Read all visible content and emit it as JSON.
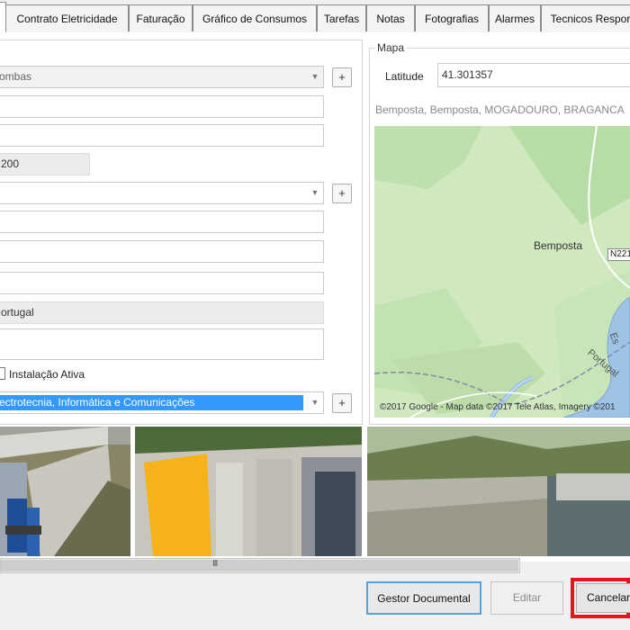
{
  "tabs": [
    "",
    "Contrato Eletricidade",
    "Faturação",
    "Gráfico de Consumos",
    "Tarefas",
    "Notas",
    "Fotografias",
    "Alarmes",
    "Tecnicos Respor"
  ],
  "form": {
    "combo1_value": "ombas",
    "field_code": "200",
    "field_country": "ortugal",
    "checkbox_label": "Instalação Ativa",
    "combo_bottom_value": "ectrotecnia, Informática e Comunicações",
    "plus": "+"
  },
  "map": {
    "group_title": "Mapa",
    "latitude_label": "Latitude",
    "latitude_value": "41.301357",
    "address": "Bemposta, Bemposta, MOGADOURO, BRAGANCA",
    "town_label": "Bemposta",
    "road_label": "N221",
    "river_label_1": "Es",
    "river_label_2": "Portugal",
    "attribution": "©2017 Google - Map data ©2017 Tele Atlas, Imagery ©201"
  },
  "scrollbar_grip": "III",
  "buttons": {
    "gestor": "Gestor Documental",
    "editar": "Editar",
    "cancelar": "Cancelar"
  },
  "colors": {
    "selection": "#3399ff",
    "highlight_border": "#e8121f",
    "map_land": "#cfe8c0",
    "map_water": "#9fc3e6"
  }
}
